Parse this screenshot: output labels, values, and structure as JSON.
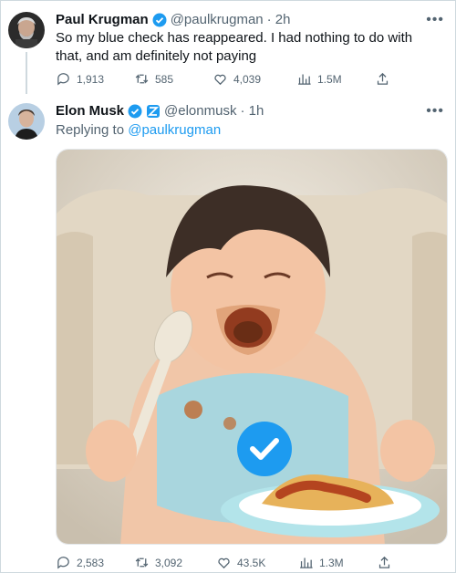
{
  "tweet1": {
    "name": "Paul Krugman",
    "handle": "@paulkrugman",
    "time": "· 2h",
    "text": "So my blue check has reappeared. I had nothing to do with that, and am definitely not paying",
    "stats": {
      "replies": "1,913",
      "retweets": "585",
      "likes": "4,039",
      "views": "1.5M"
    }
  },
  "tweet2": {
    "name": "Elon Musk",
    "handle": "@elonmusk",
    "time": "· 1h",
    "replying_prefix": "Replying to",
    "replying_handle": "@paulkrugman",
    "stats": {
      "replies": "2,583",
      "retweets": "3,092",
      "likes": "43.5K",
      "views": "1.3M"
    }
  },
  "icons": [
    "reply-icon",
    "retweet-icon",
    "like-icon",
    "views-icon",
    "share-icon",
    "verified-badge-icon",
    "more-icon"
  ],
  "colors": {
    "accent": "#1d9bf0",
    "text": "#0f1419",
    "muted": "#536471",
    "verified_affiliate": "#1d9bf0"
  }
}
